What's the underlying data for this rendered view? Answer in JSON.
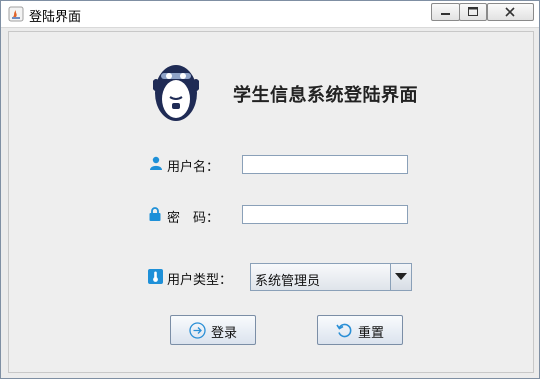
{
  "window": {
    "title": "登陆界面",
    "controls": [
      "minimize-icon",
      "maximize-icon",
      "close-icon"
    ]
  },
  "header": {
    "heading": "学生信息系统登陆界面",
    "logo_icon": "monkey-logo"
  },
  "form": {
    "username": {
      "label": "用户名：",
      "icon": "user-icon",
      "value": ""
    },
    "password": {
      "label": "密　码：",
      "icon": "lock-icon",
      "value": ""
    },
    "user_type": {
      "label": "用户类型：",
      "icon": "thermometer-icon",
      "selected": "系统管理员"
    }
  },
  "buttons": {
    "login": {
      "label": "登录",
      "icon": "arrow-right-circle-icon"
    },
    "reset": {
      "label": "重置",
      "icon": "refresh-icon"
    }
  },
  "colors": {
    "accent": "#1e90d8",
    "window_bg": "#ececec",
    "button_border": "#7b8ea6"
  }
}
